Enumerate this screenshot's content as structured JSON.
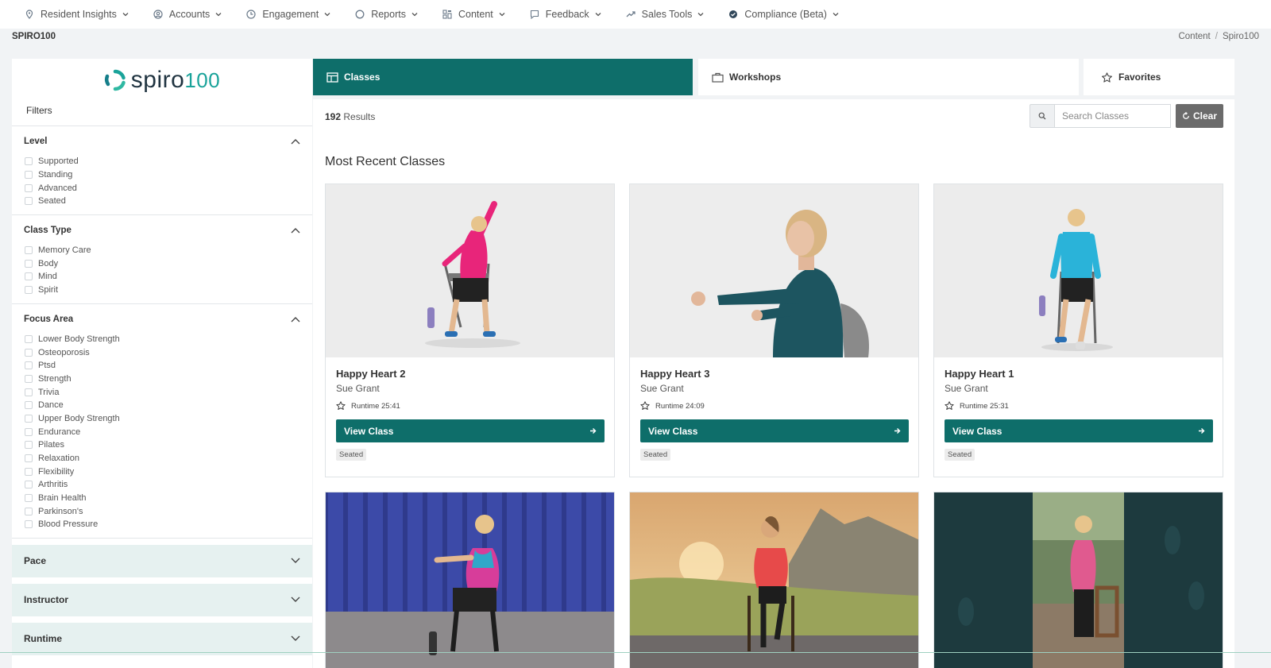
{
  "nav": [
    {
      "label": "Resident Insights",
      "icon": "pin-icon"
    },
    {
      "label": "Accounts",
      "icon": "user-circle-icon"
    },
    {
      "label": "Engagement",
      "icon": "clock-icon"
    },
    {
      "label": "Reports",
      "icon": "circle-icon"
    },
    {
      "label": "Content",
      "icon": "grid-icon"
    },
    {
      "label": "Feedback",
      "icon": "message-icon"
    },
    {
      "label": "Sales Tools",
      "icon": "trend-icon"
    },
    {
      "label": "Compliance (Beta)",
      "icon": "check-badge-icon"
    }
  ],
  "page": {
    "title": "SPIRO100"
  },
  "breadcrumb": {
    "parent": "Content",
    "separator": "/",
    "current": "Spiro100"
  },
  "sidebar": {
    "logo": {
      "word": "spiro",
      "number": "100"
    },
    "filters_label": "Filters",
    "sections": [
      {
        "title": "Level",
        "options": [
          "Supported",
          "Standing",
          "Advanced",
          "Seated"
        ]
      },
      {
        "title": "Class Type",
        "options": [
          "Memory Care",
          "Body",
          "Mind",
          "Spirit"
        ]
      },
      {
        "title": "Focus Area",
        "options": [
          "Lower Body Strength",
          "Osteoporosis",
          "Ptsd",
          "Strength",
          "Trivia",
          "Dance",
          "Upper Body Strength",
          "Endurance",
          "Pilates",
          "Relaxation",
          "Flexibility",
          "Arthritis",
          "Brain Health",
          "Parkinson's",
          "Blood Pressure"
        ]
      }
    ],
    "collapsed": [
      "Pace",
      "Instructor",
      "Runtime"
    ]
  },
  "tabs": {
    "classes": "Classes",
    "workshops": "Workshops",
    "favorites": "Favorites"
  },
  "results": {
    "count": "192",
    "label": "Results"
  },
  "search": {
    "placeholder": "Search Classes",
    "clear": "Clear"
  },
  "section_title": "Most Recent Classes",
  "cards": [
    {
      "title": "Happy Heart 2",
      "instructor": "Sue Grant",
      "runtime": "Runtime 25:41",
      "button": "View Class",
      "tag": "Seated"
    },
    {
      "title": "Happy Heart 3",
      "instructor": "Sue Grant",
      "runtime": "Runtime 24:09",
      "button": "View Class",
      "tag": "Seated"
    },
    {
      "title": "Happy Heart 1",
      "instructor": "Sue Grant",
      "runtime": "Runtime 25:31",
      "button": "View Class",
      "tag": "Seated"
    }
  ],
  "colors": {
    "primary": "#0e6e6a",
    "accent": "#1aa39a",
    "clear_button": "#6b6b6b",
    "collapsed_bg": "#e6f1f0"
  }
}
